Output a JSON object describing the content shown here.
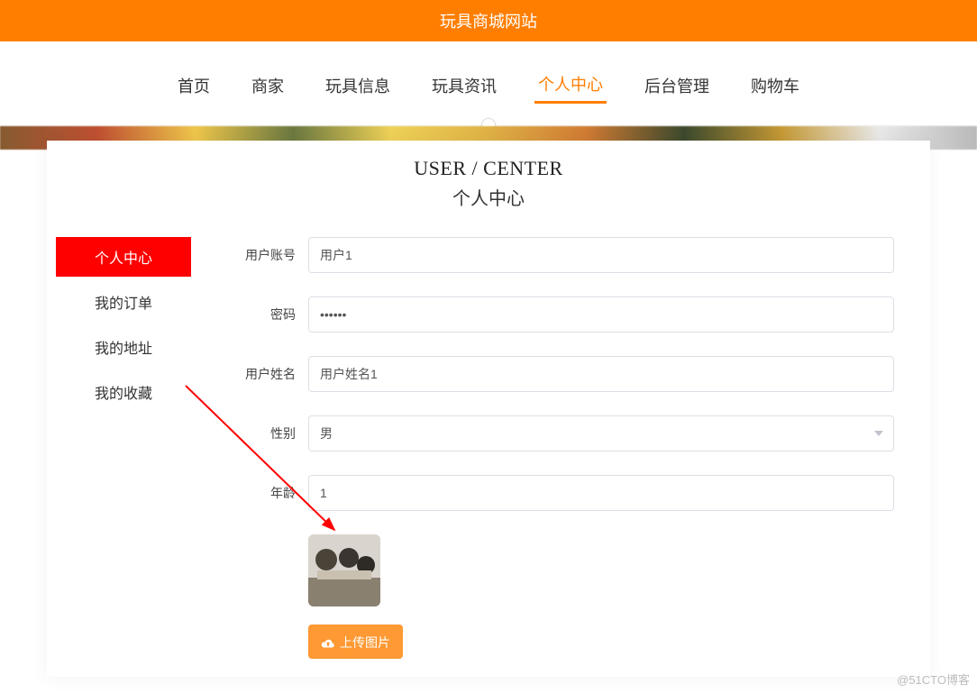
{
  "header": {
    "site_title": "玩具商城网站"
  },
  "nav": {
    "items": [
      {
        "label": "首页"
      },
      {
        "label": "商家"
      },
      {
        "label": "玩具信息"
      },
      {
        "label": "玩具资讯"
      },
      {
        "label": "个人中心",
        "active": true
      },
      {
        "label": "后台管理"
      },
      {
        "label": "购物车"
      }
    ]
  },
  "page": {
    "title_en": "USER / CENTER",
    "title_cn": "个人中心"
  },
  "sidebar": {
    "items": [
      {
        "label": "个人中心",
        "active": true
      },
      {
        "label": "我的订单"
      },
      {
        "label": "我的地址"
      },
      {
        "label": "我的收藏"
      }
    ]
  },
  "form": {
    "account_label": "用户账号",
    "account_value": "用户1",
    "password_label": "密码",
    "password_value": "••••••",
    "name_label": "用户姓名",
    "name_value": "用户姓名1",
    "gender_label": "性别",
    "gender_value": "男",
    "age_label": "年龄",
    "age_value": "1",
    "upload_label": "上传图片"
  },
  "watermark": "@51CTO博客"
}
